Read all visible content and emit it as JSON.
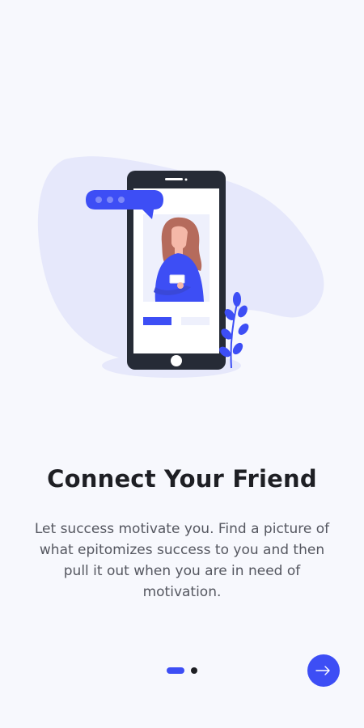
{
  "onboarding": {
    "title": "Connect Your Friend",
    "description": "Let success motivate you. Find a picture of what epitomizes success to you and then pull it out when you are in need of motivation.",
    "page_index": 1,
    "page_count": 2
  },
  "colors": {
    "accent": "#3d4ef5",
    "background": "#f7f8fd",
    "title": "#1e1f24",
    "body": "#555760"
  },
  "icons": {
    "next": "arrow-right-icon"
  }
}
